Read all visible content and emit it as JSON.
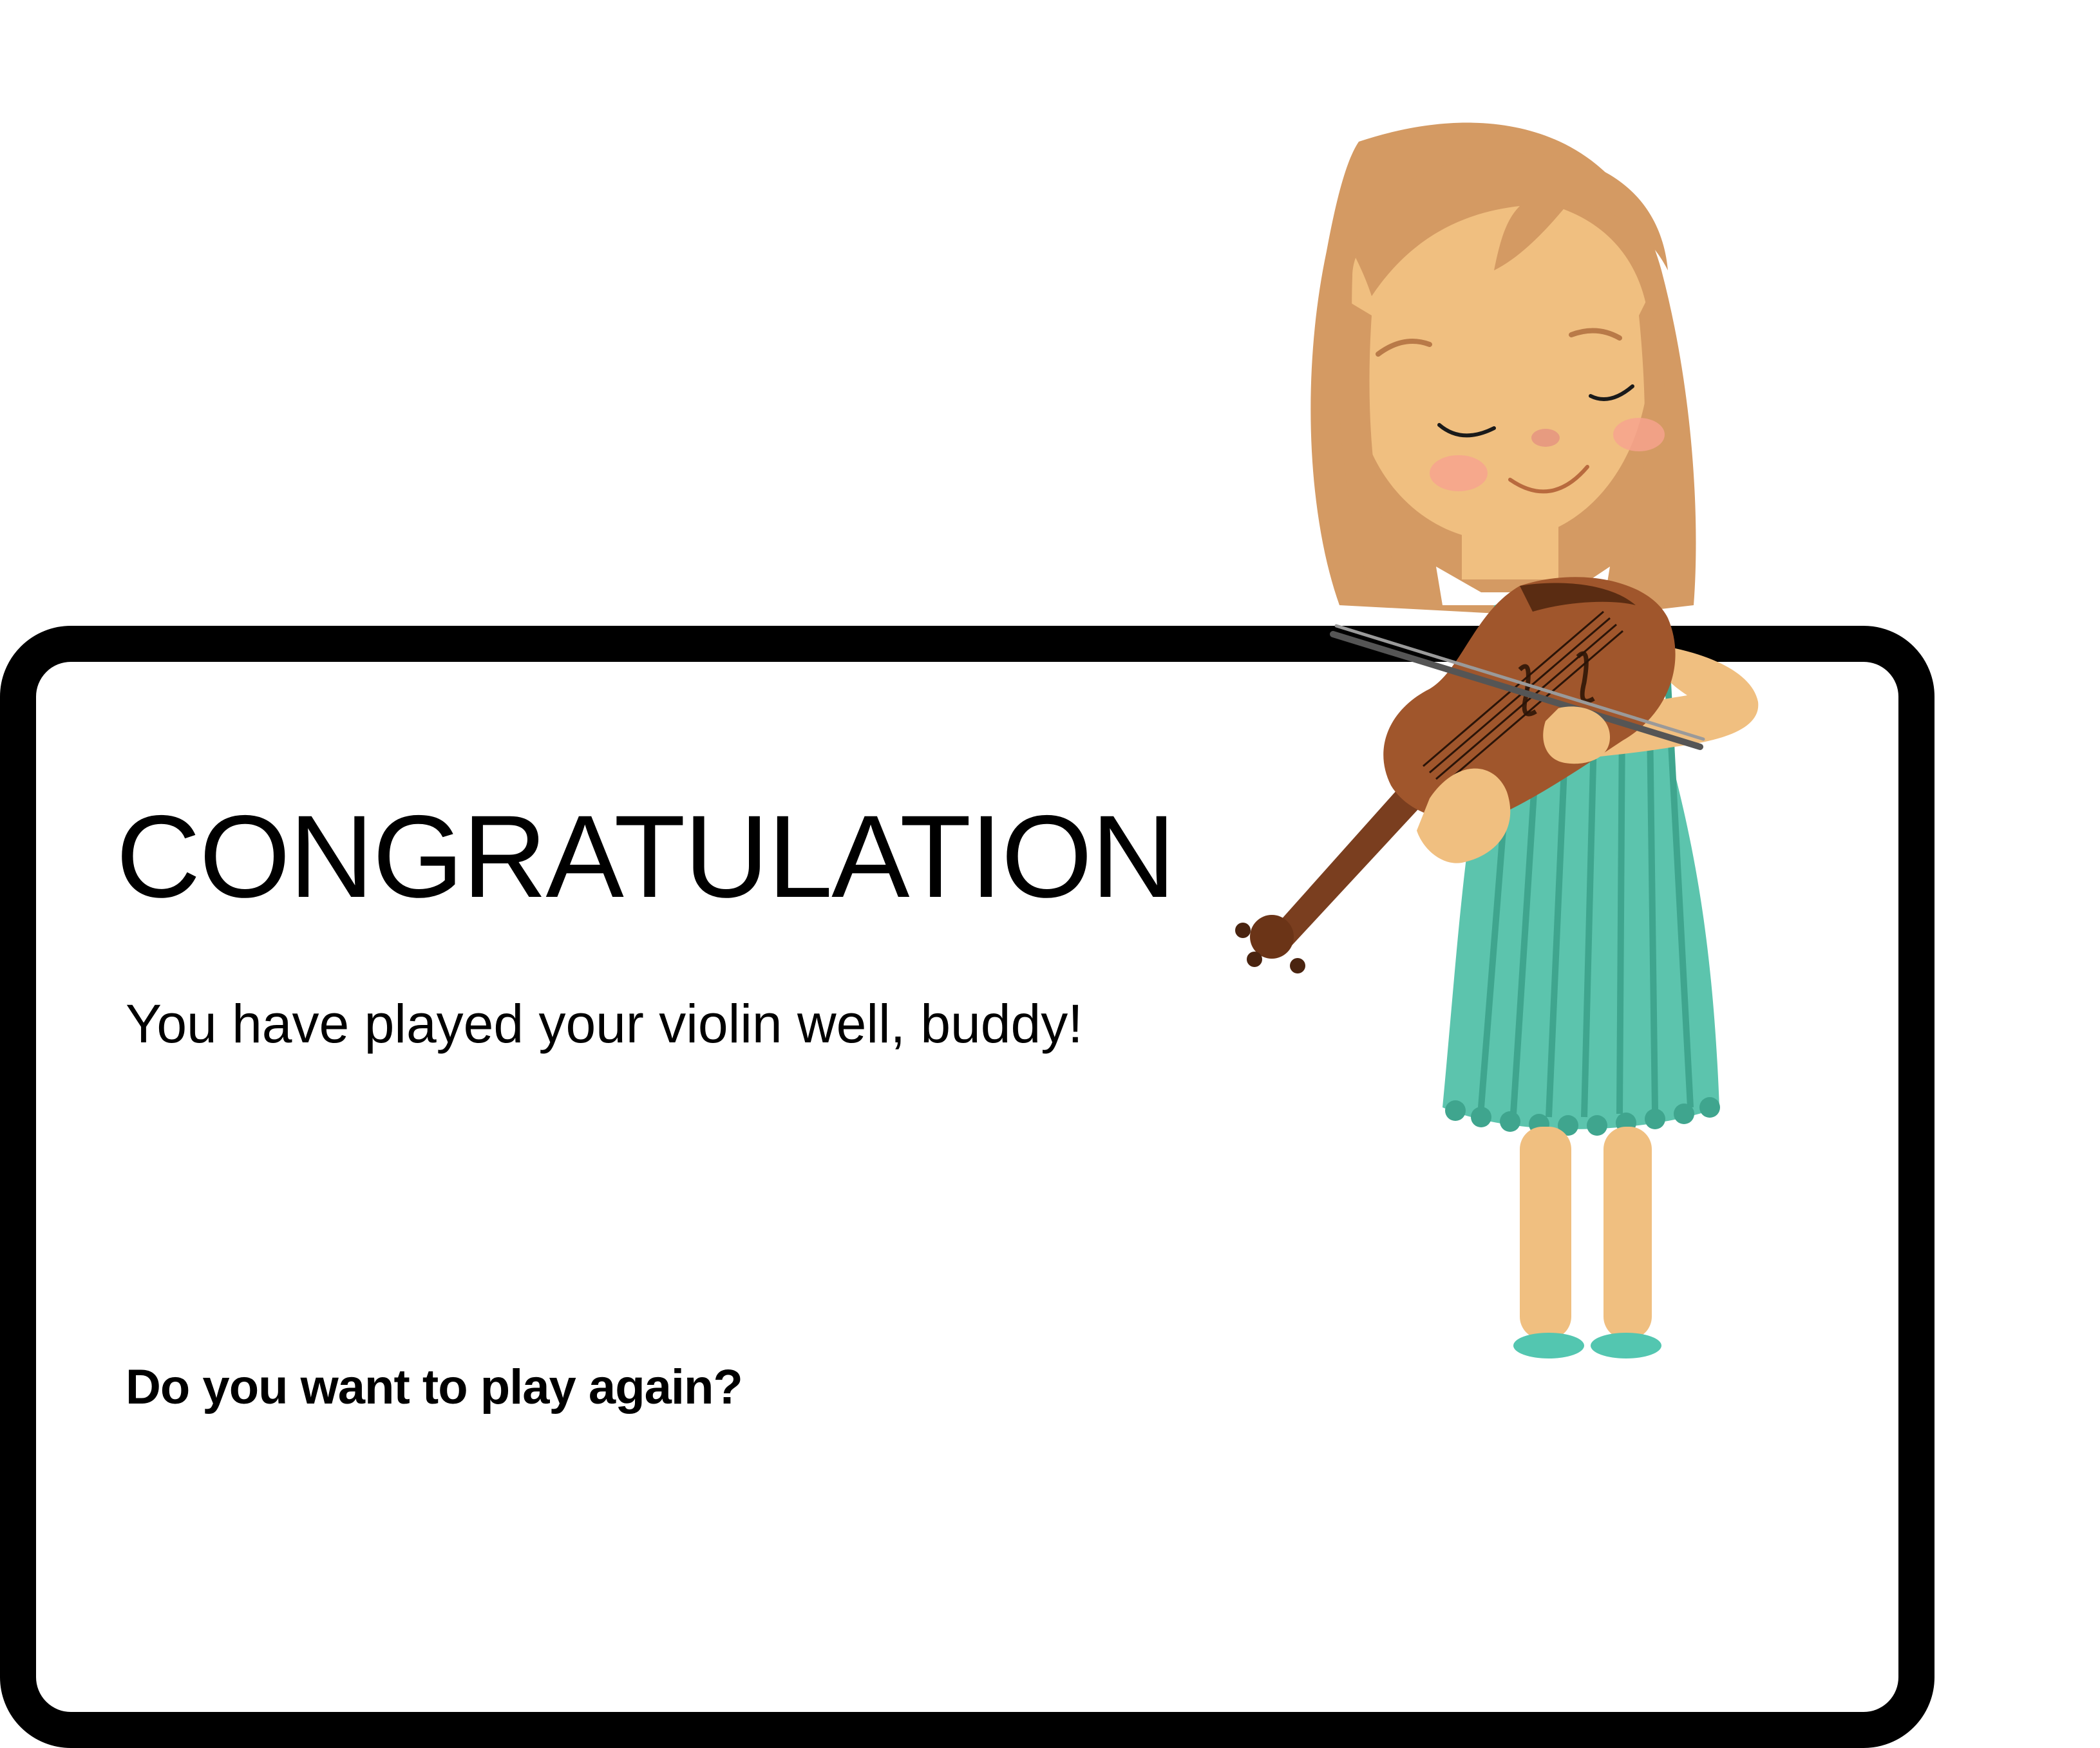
{
  "dialog": {
    "title": "CONGRATULATION",
    "message": "You have played your violin well, buddy!",
    "prompt": "Do you want to play again?"
  },
  "illustration": {
    "icon": "girl-playing-violin-illustration"
  },
  "colors": {
    "border": "#000000",
    "background": "#ffffff",
    "hair": "#d49a63",
    "skin": "#f0bf80",
    "dress": "#5cc4ad",
    "violin": "#a0562c"
  }
}
